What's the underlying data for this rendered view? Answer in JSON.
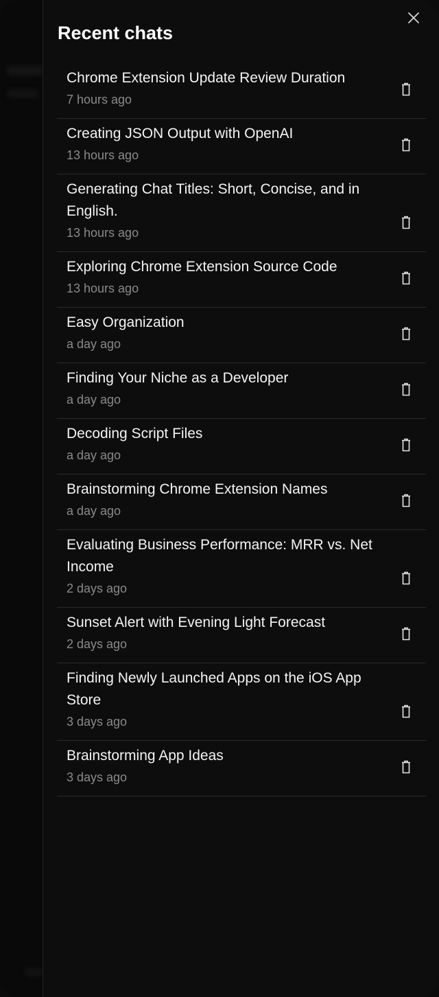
{
  "panel": {
    "title": "Recent chats"
  },
  "icons": {
    "close": "close-icon",
    "delete": "trash-icon"
  },
  "chats": [
    {
      "title": "Chrome Extension Update Review Duration",
      "time": "7 hours ago"
    },
    {
      "title": "Creating JSON Output with OpenAI",
      "time": "13 hours ago"
    },
    {
      "title": "Generating Chat Titles: Short, Concise, and in English.",
      "time": "13 hours ago"
    },
    {
      "title": "Exploring Chrome Extension Source Code",
      "time": "13 hours ago"
    },
    {
      "title": "Easy Organization",
      "time": "a day ago"
    },
    {
      "title": "Finding Your Niche as a Developer",
      "time": "a day ago"
    },
    {
      "title": "Decoding Script Files",
      "time": "a day ago"
    },
    {
      "title": "Brainstorming Chrome Extension Names",
      "time": "a day ago"
    },
    {
      "title": "Evaluating Business Performance: MRR vs. Net Income",
      "time": "2 days ago"
    },
    {
      "title": "Sunset Alert with Evening Light Forecast",
      "time": "2 days ago"
    },
    {
      "title": "Finding Newly Launched Apps on the iOS App Store",
      "time": "3 days ago"
    },
    {
      "title": "Brainstorming App Ideas",
      "time": "3 days ago"
    }
  ]
}
